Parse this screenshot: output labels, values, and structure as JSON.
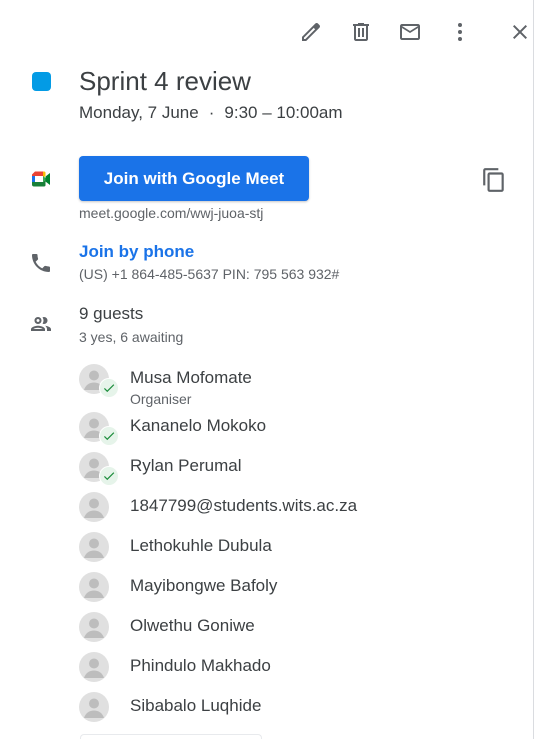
{
  "event": {
    "title": "Sprint 4 review",
    "date": "Monday, 7 June",
    "separator": "·",
    "time": "9:30 – 10:00am",
    "color": "#039be5"
  },
  "toolbar": {
    "icons": [
      "edit-icon",
      "delete-icon",
      "email-icon",
      "more-options-icon",
      "close-icon"
    ]
  },
  "meet": {
    "button_label": "Join with Google Meet",
    "url": "meet.google.com/wwj-juoa-stj",
    "accent": "#1a73e8"
  },
  "phone": {
    "label": "Join by phone",
    "details": "(US) +1 864-485-5637 PIN: 795 563 932#"
  },
  "guests": {
    "count_label": "9 guests",
    "summary": "3 yes, 6 awaiting",
    "list": [
      {
        "name": "Musa Mofomate",
        "role": "Organiser",
        "accepted": true
      },
      {
        "name": "Kananelo Mokoko",
        "accepted": true
      },
      {
        "name": "Rylan Perumal",
        "accepted": true
      },
      {
        "name": "1847799@students.wits.ac.za",
        "accepted": false
      },
      {
        "name": "Lethokuhle Dubula",
        "accepted": false
      },
      {
        "name": "Mayibongwe Bafoly",
        "accepted": false
      },
      {
        "name": "Olwethu Goniwe",
        "accepted": false
      },
      {
        "name": "Phindulo Makhado",
        "accepted": false
      },
      {
        "name": "Sibabalo Luqhide",
        "accepted": false
      }
    ]
  }
}
